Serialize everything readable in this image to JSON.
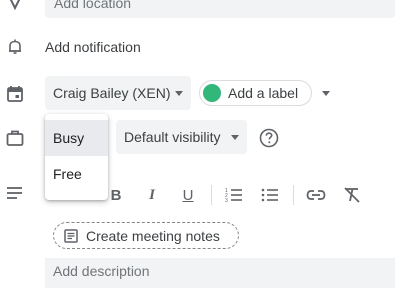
{
  "location": {
    "placeholder": "Add location",
    "icon": "location-pin-icon"
  },
  "notification": {
    "label": "Add notification",
    "icon": "bell-icon"
  },
  "calendar": {
    "selected": "Craig Bailey (XEN)",
    "icon": "calendar-icon"
  },
  "label": {
    "text": "Add a label",
    "color": "#33b679"
  },
  "busy_menu": {
    "options": [
      {
        "label": "Busy",
        "selected": true
      },
      {
        "label": "Free",
        "selected": false
      }
    ],
    "icon": "briefcase-icon"
  },
  "visibility": {
    "selected": "Default visibility",
    "help_icon": "help-circle-icon"
  },
  "toolbar": {
    "bold": "B",
    "italic": "I",
    "underline": "U",
    "icons": [
      "bold-icon",
      "italic-icon",
      "underline-icon",
      "numbered-list-icon",
      "bulleted-list-icon",
      "link-icon",
      "clear-formatting-icon"
    ]
  },
  "meeting_notes": {
    "label": "Create meeting notes",
    "icon": "notes-doc-icon"
  },
  "description": {
    "placeholder": "Add description",
    "icon": "description-lines-icon"
  },
  "colors": {
    "field_bg": "#f1f3f4",
    "text": "#3c4043",
    "icon": "#5f6368",
    "label_dot": "#33b679"
  }
}
